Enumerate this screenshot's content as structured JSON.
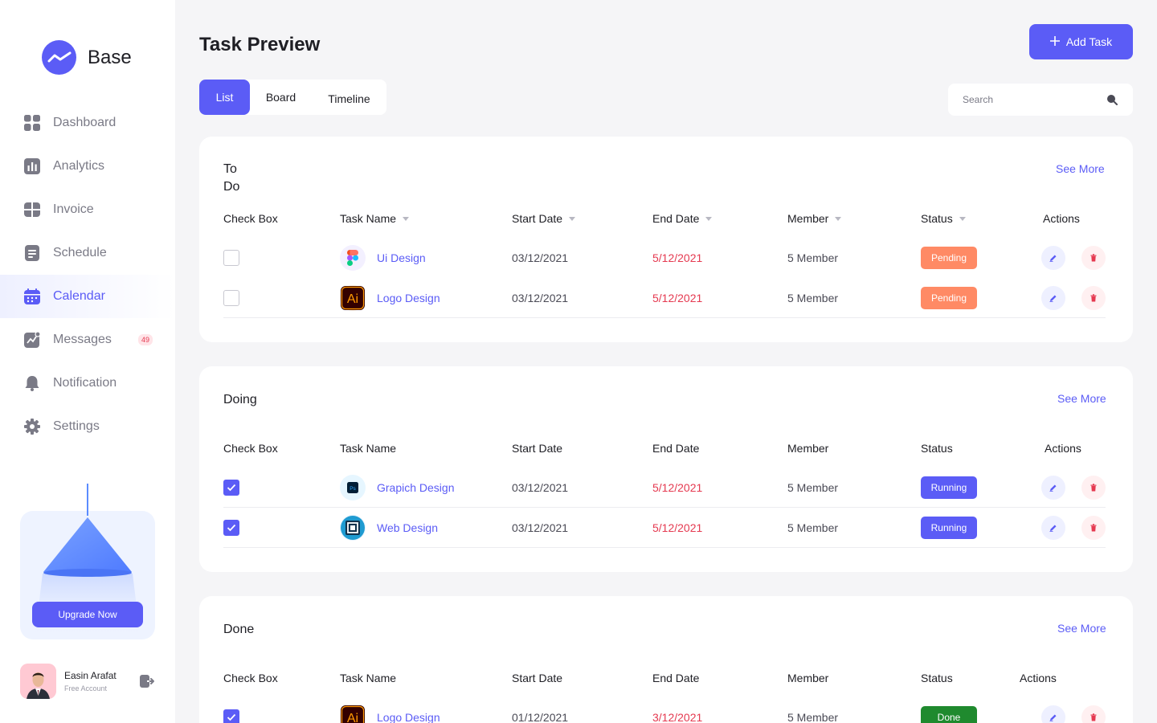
{
  "brand": {
    "name": "Base"
  },
  "sidebar": {
    "items": [
      {
        "label": "Dashboard",
        "icon": "dashboard-icon",
        "active": false
      },
      {
        "label": "Analytics",
        "icon": "analytics-icon",
        "active": false
      },
      {
        "label": "Invoice",
        "icon": "invoice-icon",
        "active": false
      },
      {
        "label": "Schedule",
        "icon": "schedule-icon",
        "active": false
      },
      {
        "label": "Calendar",
        "icon": "calendar-icon",
        "active": true
      },
      {
        "label": "Messages",
        "icon": "messages-icon",
        "active": false,
        "badge": "49"
      },
      {
        "label": "Notification",
        "icon": "bell-icon",
        "active": false
      },
      {
        "label": "Settings",
        "icon": "gear-icon",
        "active": false
      }
    ],
    "upgrade_label": "Upgrade Now"
  },
  "user": {
    "name": "Easin Arafat",
    "plan": "Free Account"
  },
  "header": {
    "title": "Task Preview",
    "add_label": "Add Task",
    "tabs": [
      "List",
      "Board",
      "Timeline"
    ],
    "active_tab": "List",
    "search_placeholder": "Search"
  },
  "colors": {
    "accent": "#5b5cf6",
    "pending": "#ff8a65",
    "running": "#5b5cf6",
    "done": "#1f8a2e",
    "danger": "#e53950"
  },
  "sections": [
    {
      "title_line1": "To",
      "title_line2": "Do",
      "see_more": "See More",
      "columns": [
        "Check Box",
        "Task Name",
        "Start Date",
        "End Date",
        "Member",
        "Status",
        "Actions"
      ],
      "rows": [
        {
          "checked": false,
          "app": "figma",
          "task": "Ui Design",
          "start": "03/12/2021",
          "end": "5/12/2021",
          "member": "5 Member",
          "status": "Pending"
        },
        {
          "checked": false,
          "app": "illustrator",
          "task": "Logo Design",
          "start": "03/12/2021",
          "end": "5/12/2021",
          "member": "5 Member",
          "status": "Pending"
        }
      ]
    },
    {
      "title": "Doing",
      "see_more": "See More",
      "columns": [
        "Check Box",
        "Task Name",
        "Start Date",
        "End Date",
        "Member",
        "Status",
        "Actions"
      ],
      "rows": [
        {
          "checked": true,
          "app": "photoshop",
          "task": "Grapich Design",
          "start": "03/12/2021",
          "end": "5/12/2021",
          "member": "5 Member",
          "status": "Running"
        },
        {
          "checked": true,
          "app": "web",
          "task": "Web Design",
          "start": "03/12/2021",
          "end": "5/12/2021",
          "member": "5 Member",
          "status": "Running"
        }
      ]
    },
    {
      "title": "Done",
      "see_more": "See More",
      "columns": [
        "Check Box",
        "Task Name",
        "Start Date",
        "End Date",
        "Member",
        "Status",
        "Actions"
      ],
      "rows": [
        {
          "checked": true,
          "app": "illustrator",
          "task": "Logo Design",
          "start": "01/12/2021",
          "end": "3/12/2021",
          "member": "5 Member",
          "status": "Done"
        }
      ]
    }
  ]
}
